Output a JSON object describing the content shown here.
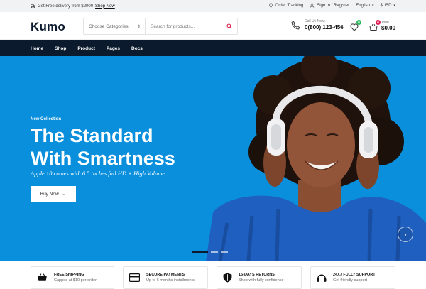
{
  "topbar": {
    "promo_text": "Get Free delivery from $2000",
    "promo_link": "Shop Now",
    "order_tracking": "Order Tracking",
    "account": "Sign In / Register",
    "language": "English",
    "currency": "$USD"
  },
  "header": {
    "logo": "Kumo",
    "search": {
      "category": "Choose Categories",
      "placeholder": "Search for products..."
    },
    "call": {
      "label": "Call Us Now:",
      "number": "0(800) 123-456"
    },
    "wishlist_count": "0",
    "cart_count": "0",
    "total_label": "Total",
    "total_amount": "$0.00"
  },
  "nav": {
    "items": [
      "Home",
      "Shop",
      "Product",
      "Pages",
      "Docs"
    ]
  },
  "hero": {
    "kicker": "New Collection",
    "title_line1": "The Standard",
    "title_line2": "With Smartness",
    "subtitle": "Apple 10 comes with 6.5 tnches full HD + High Valume",
    "cta": "Buy Now",
    "bg_color": "#0a8fdc"
  },
  "features": [
    {
      "title": "FREE SHIPPING",
      "subtitle": "Capped at $10 per order",
      "icon": "cart-icon"
    },
    {
      "title": "SECURE PAYMENTS",
      "subtitle": "Up to 6 months installments",
      "icon": "credit-card-icon"
    },
    {
      "title": "15-DAYS RETURNS",
      "subtitle": "Shop with fully confidence",
      "icon": "shield-icon"
    },
    {
      "title": "24X7 FULLY SUPPORT",
      "subtitle": "Get friendly support",
      "icon": "headset-icon"
    }
  ],
  "colors": {
    "accent": "#e01e4f",
    "navy": "#0b1a2c",
    "wishlist_badge": "#2dbb5d"
  }
}
